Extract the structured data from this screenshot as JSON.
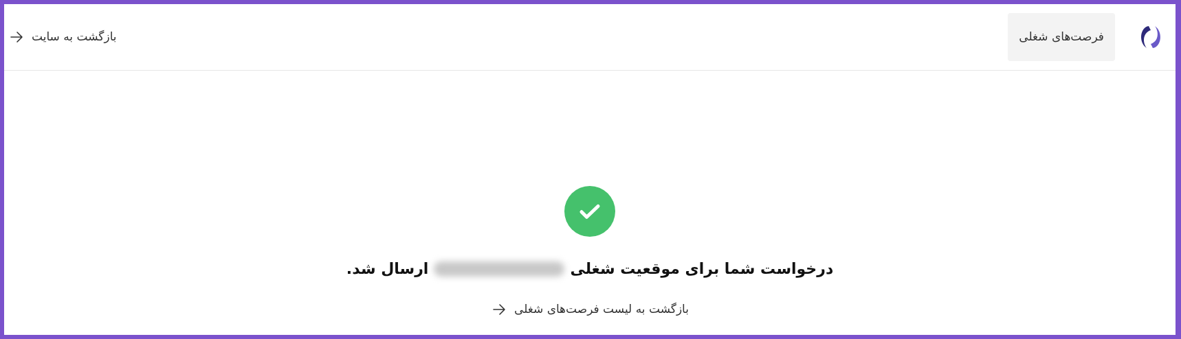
{
  "header": {
    "nav_button": "فرصت‌های شغلی",
    "back_link": "بازگشت به سایت"
  },
  "result": {
    "message_start": "درخواست شما برای موقعیت شغلی",
    "message_end": "ارسال شد.",
    "back_link": "بازگشت به لیست فرصت‌های شغلی"
  }
}
